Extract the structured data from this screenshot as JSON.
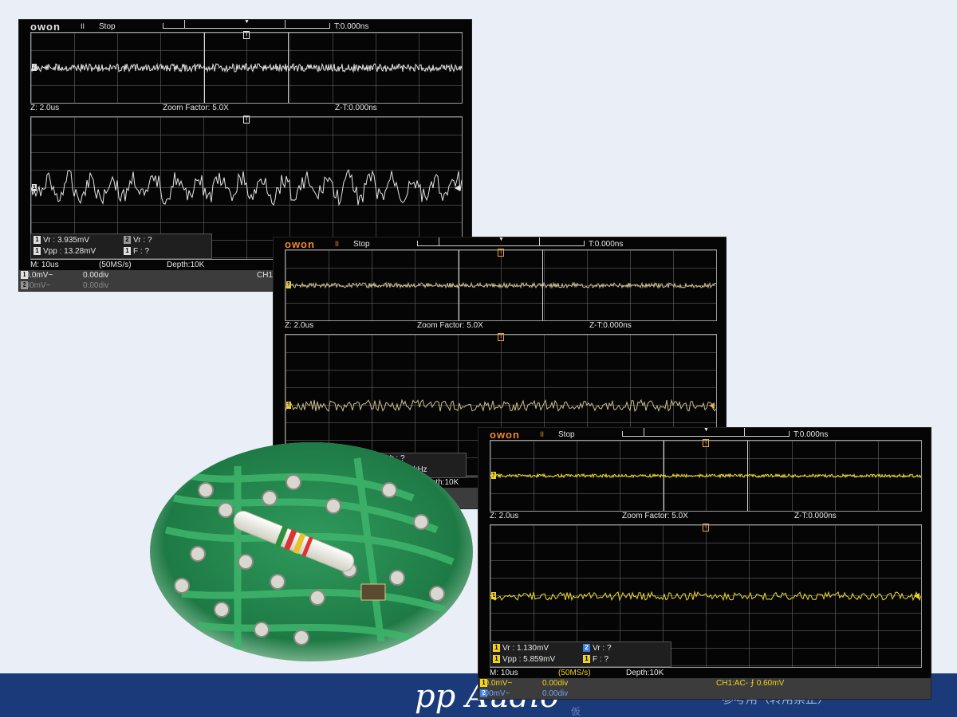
{
  "footer": {
    "brand": "pp Audio",
    "small": "仮",
    "right": "参考用（转用禁止）"
  },
  "scopes": [
    {
      "logo": "owon",
      "run_icon": "II",
      "status": "Stop",
      "trigger_time": "T:0.000ns",
      "zoom_time": "Z: 2.0us",
      "zoom_factor": "Zoom Factor: 5.0X",
      "zoom_trig": "Z-T:0.000ns",
      "meas": {
        "vr1": "Vr : 3.935mV",
        "vr2": "Vr :    ?",
        "vpp1": "Vpp : 13.28mV",
        "f1": "F :    ?",
        "b1": "1",
        "b2": "2"
      },
      "timebase": "M: 10us",
      "sample_rate": "(50MS/s)",
      "depth": "Depth:10K",
      "ch1": {
        "num": "1",
        "scale": "10.0mV~",
        "offset": "0.00div"
      },
      "ch2": {
        "num": "2",
        "scale": "100mV~",
        "offset": "0.00div"
      },
      "trigger_info": "CH1"
    },
    {
      "logo": "owon",
      "run_icon": "II",
      "status": "Stop",
      "trigger_time": "T:0.000ns",
      "zoom_time": "Z: 2.0us",
      "zoom_factor": "Zoom Factor: 5.0X",
      "zoom_trig": "Z-T:0.000ns",
      "meas": {
        "vr2": "Vr :    ?",
        "freq": "22.2kHz",
        "b2": "2"
      },
      "depth": "Depth:10K"
    },
    {
      "logo": "owon",
      "run_icon": "II",
      "status": "Stop",
      "trigger_time": "T:0.000ns",
      "zoom_time": "Z: 2.0us",
      "zoom_factor": "Zoom Factor: 5.0X",
      "zoom_trig": "Z-T:0.000ns",
      "meas": {
        "vr1": "Vr : 1.130mV",
        "vr2": "Vr :    ?",
        "vpp1": "Vpp : 5.859mV",
        "f1": "F :    ?",
        "b1": "1",
        "b2": "2"
      },
      "timebase": "M: 10us",
      "sample_rate": "(50MS/s)",
      "depth": "Depth:10K",
      "ch1": {
        "num": "1",
        "scale": "10.0mV~",
        "offset": "0.00div"
      },
      "ch2": {
        "num": "2",
        "scale": "100mV~",
        "offset": "0.00div"
      },
      "trigger_info": "CH1:AC- ⨍ 0.60mV"
    }
  ],
  "colors": {
    "background": "#e9eef7",
    "footer": "#1b3a7a",
    "trace_white": "#e4e4e4",
    "trace_tan": "#cbbf8f",
    "trace_yellow": "#f2dd2b",
    "logo_orange": "#f08a24"
  },
  "photo": {
    "icon": "pcb-resistor-photo"
  }
}
